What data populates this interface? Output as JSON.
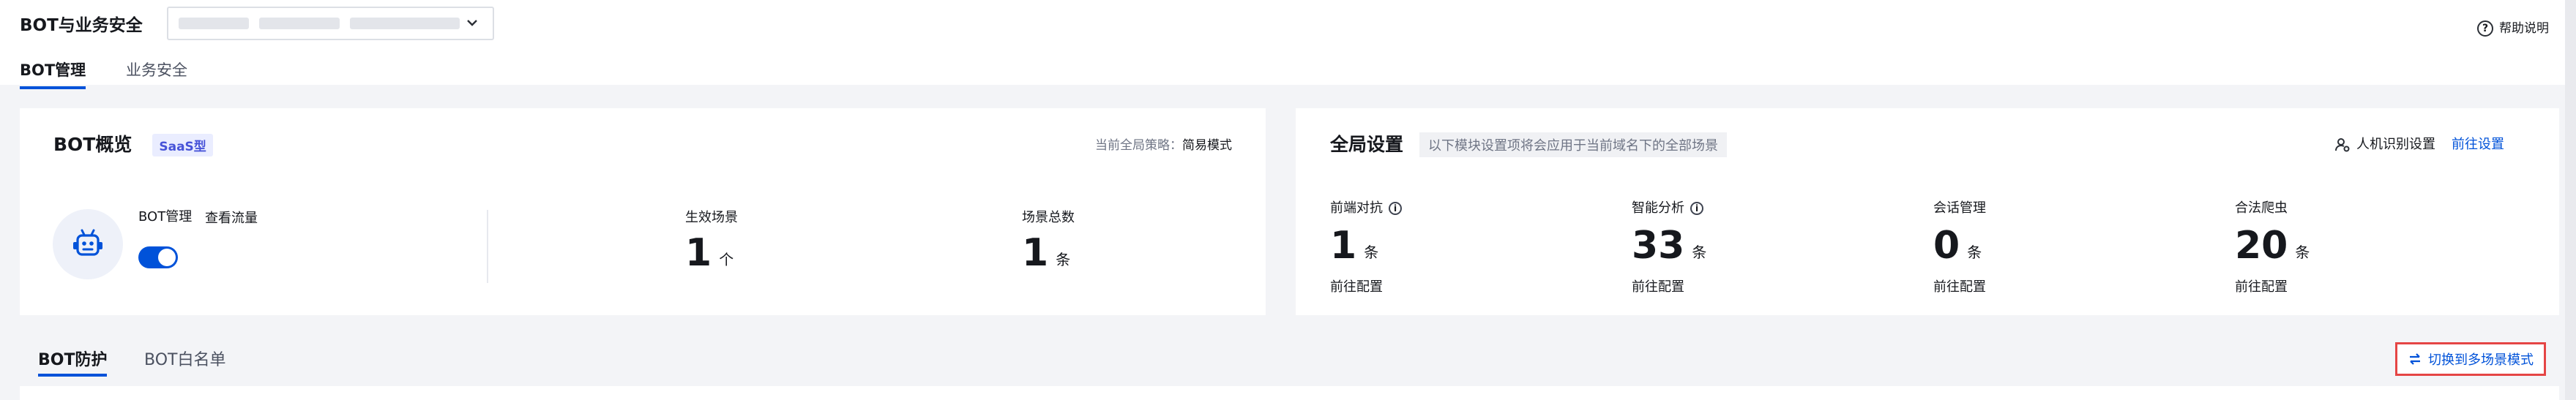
{
  "header": {
    "title": "BOT与业务安全",
    "help_label": "帮助说明",
    "tabs": [
      {
        "label": "BOT管理",
        "active": true
      },
      {
        "label": "业务安全",
        "active": false
      }
    ],
    "domain_select_icon": "chevron-down-icon"
  },
  "overview": {
    "title": "BOT概览",
    "badge": "SaaS型",
    "strategy_label": "当前全局策略：",
    "strategy_value": "简易模式",
    "bot_manage_label": "BOT管理",
    "view_traffic_link": "查看流量",
    "toggle_on": true,
    "stats": [
      {
        "label": "生效场景",
        "value": "1",
        "unit": "个"
      },
      {
        "label": "场景总数",
        "value": "1",
        "unit": "条"
      }
    ]
  },
  "global": {
    "title": "全局设置",
    "description": "以下模块设置项将会应用于当前域名下的全部场景",
    "captcha_label": "人机识别设置",
    "goto_settings": "前往设置",
    "items": [
      {
        "label": "前端对抗",
        "value": "1",
        "unit": "条",
        "link": "前往配置",
        "info": true
      },
      {
        "label": "智能分析",
        "value": "33",
        "unit": "条",
        "link": "前往配置",
        "info": true
      },
      {
        "label": "会话管理",
        "value": "0",
        "unit": "条",
        "link": "前往配置",
        "info": false
      },
      {
        "label": "合法爬虫",
        "value": "20",
        "unit": "条",
        "link": "前往配置",
        "info": false
      }
    ]
  },
  "bottom_tabs": [
    {
      "label": "BOT防护",
      "active": true
    },
    {
      "label": "BOT白名单",
      "active": false
    }
  ],
  "switch_button": {
    "label": "切换到多场景模式",
    "icon": "swap-icon"
  },
  "colors": {
    "accent": "#0052d9",
    "highlight_border": "#e54545",
    "badge_text": "#4753d8",
    "badge_bg": "#eaedff"
  }
}
